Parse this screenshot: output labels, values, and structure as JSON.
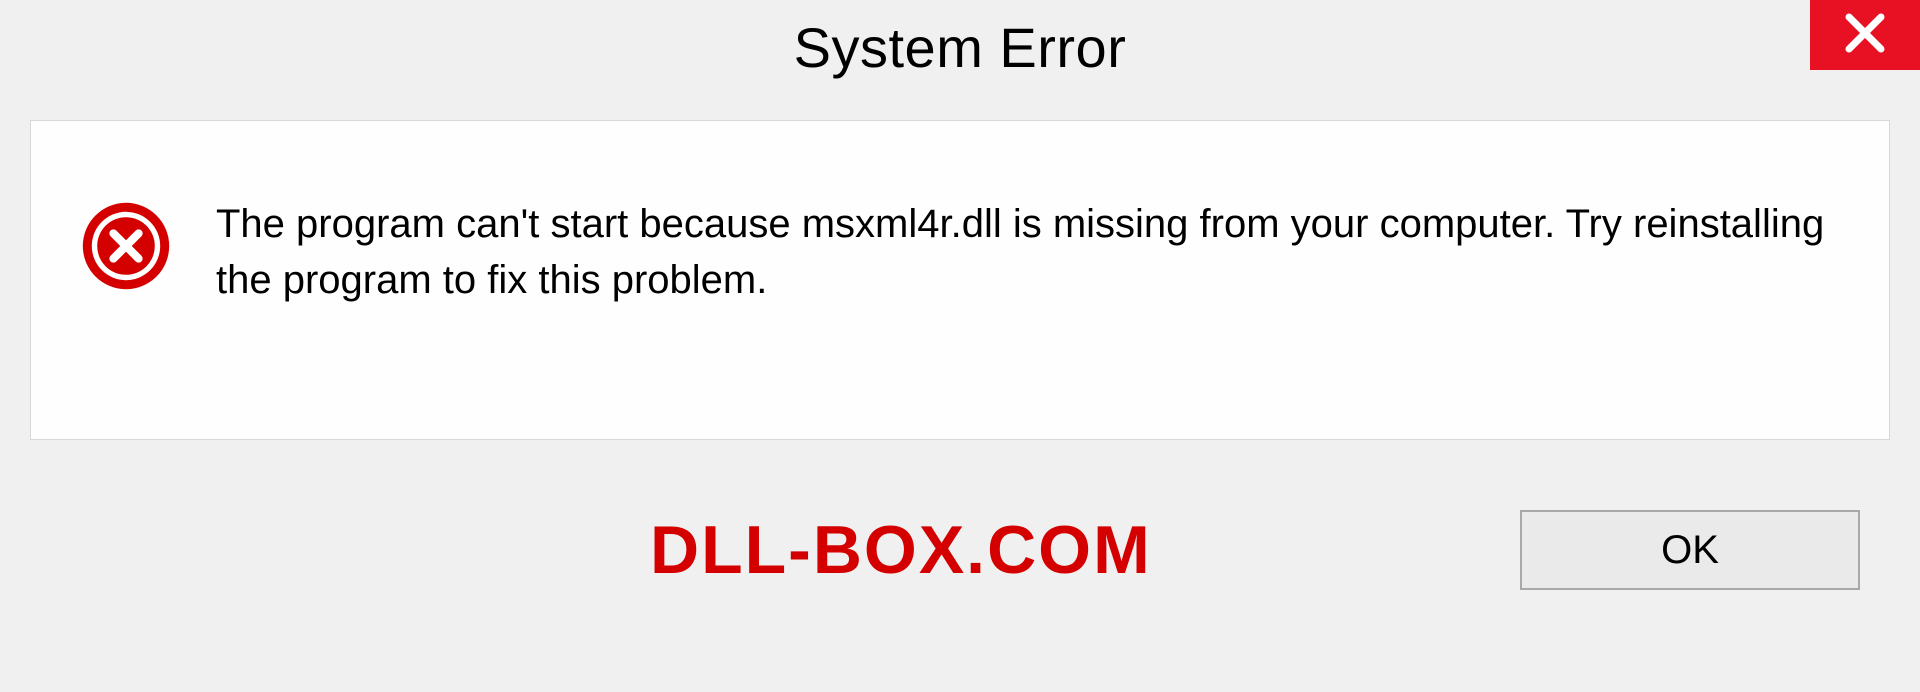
{
  "dialog": {
    "title": "System Error",
    "message": "The program can't start because msxml4r.dll is missing from your computer. Try reinstalling the program to fix this problem.",
    "ok_label": "OK"
  },
  "watermark": "DLL-BOX.COM",
  "colors": {
    "close_bg": "#e81123",
    "error_red": "#d40000",
    "button_bg": "#eaeaea",
    "button_border": "#a8a8a8"
  }
}
